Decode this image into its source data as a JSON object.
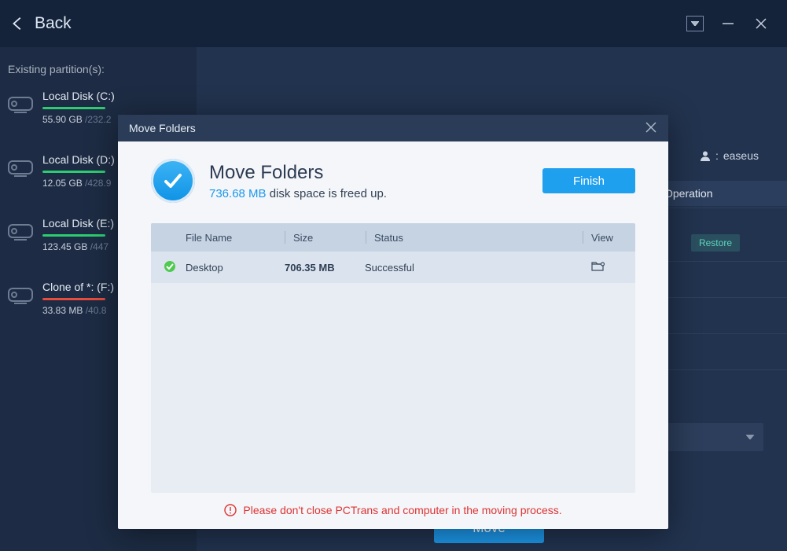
{
  "titlebar": {
    "back": "Back"
  },
  "left": {
    "heading": "Existing partition(s):",
    "partitions": [
      {
        "name": "Local Disk (C:)",
        "used": "55.90 GB",
        "total": "/232.2",
        "bar": "green"
      },
      {
        "name": "Local Disk (D:)",
        "used": "12.05 GB",
        "total": "/428.9",
        "bar": "green"
      },
      {
        "name": "Local Disk (E:)",
        "used": "123.45 GB",
        "total": "/447",
        "bar": "green"
      },
      {
        "name": "Clone of *: (F:)",
        "used": "33.83 MB",
        "total": "/40.8",
        "bar": "red"
      }
    ]
  },
  "right": {
    "user": "easeus",
    "operation_header": "Operation",
    "restore": "Restore",
    "move": "Move"
  },
  "modal": {
    "title": "Move Folders",
    "heading": "Move Folders",
    "freed_size": "736.68 MB",
    "freed_tail": " disk space is freed up.",
    "finish": "Finish",
    "columns": {
      "name": "File Name",
      "size": "Size",
      "status": "Status",
      "view": "View"
    },
    "rows": [
      {
        "name": "Desktop",
        "size": "706.35 MB",
        "status": "Successful"
      }
    ],
    "warning": "Please don't close PCTrans and computer in the moving process."
  }
}
